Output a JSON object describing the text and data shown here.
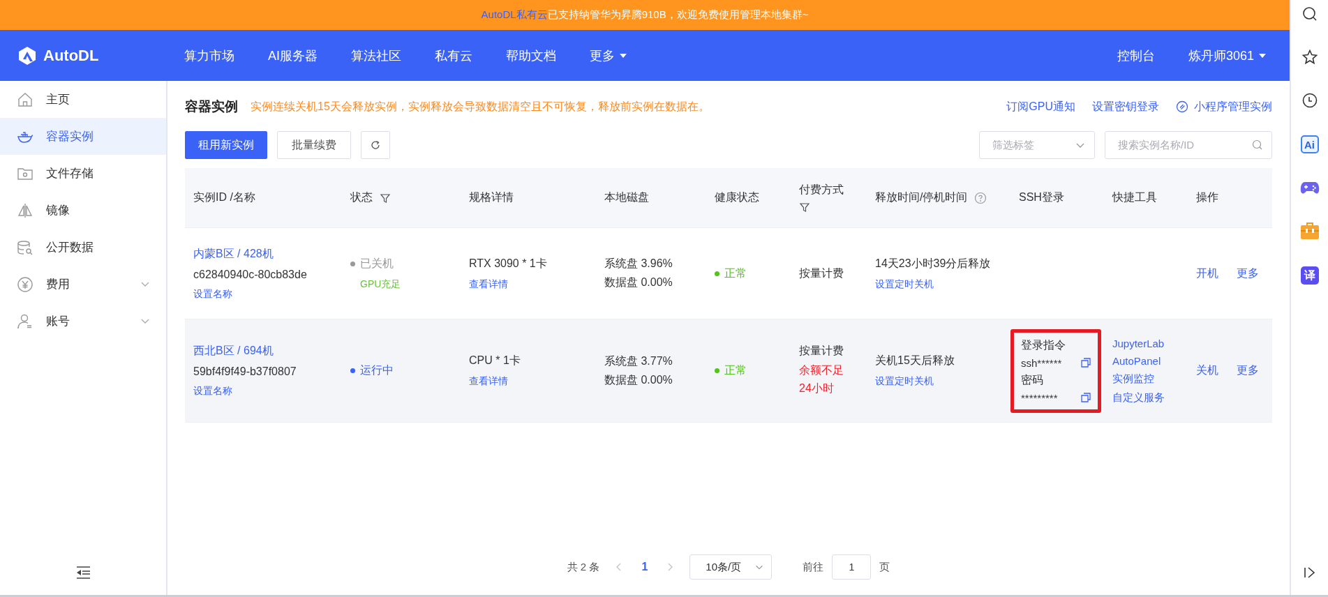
{
  "banner": {
    "link": "AutoDL私有云",
    "text": "已支持纳管华为昇腾910B，欢迎免费使用管理本地集群~"
  },
  "nav": {
    "logo": "AutoDL",
    "items": [
      {
        "label": "算力市场",
        "dropdown": false
      },
      {
        "label": "AI服务器",
        "dropdown": false
      },
      {
        "label": "算法社区",
        "dropdown": false
      },
      {
        "label": "私有云",
        "dropdown": false
      },
      {
        "label": "帮助文档",
        "dropdown": false
      },
      {
        "label": "更多",
        "dropdown": true
      }
    ],
    "console": "控制台",
    "user": "炼丹师3061"
  },
  "sidebar": {
    "items": [
      {
        "label": "主页",
        "kind": "home",
        "selected": false,
        "expandable": false
      },
      {
        "label": "容器实例",
        "kind": "container",
        "selected": true,
        "expandable": false
      },
      {
        "label": "文件存储",
        "kind": "folder",
        "selected": false,
        "expandable": false
      },
      {
        "label": "镜像",
        "kind": "mirror",
        "selected": false,
        "expandable": false
      },
      {
        "label": "公开数据",
        "kind": "database",
        "selected": false,
        "expandable": false
      },
      {
        "label": "费用",
        "kind": "yen",
        "selected": false,
        "expandable": true
      },
      {
        "label": "账号",
        "kind": "user",
        "selected": false,
        "expandable": true
      }
    ]
  },
  "page": {
    "title": "容器实例",
    "notice": "实例连续关机15天会释放实例，实例释放会导致数据清空且不可恢复，释放前实例在数据在。",
    "links": [
      {
        "label": "订阅GPU通知",
        "kind": "plain"
      },
      {
        "label": "设置密钥登录",
        "kind": "plain"
      },
      {
        "label": "小程序管理实例",
        "kind": "mini-program"
      }
    ]
  },
  "toolbar": {
    "buttons": [
      {
        "kind": "primary",
        "label": "租用新实例"
      },
      {
        "kind": "default",
        "label": "批量续费"
      },
      {
        "kind": "refresh"
      }
    ],
    "tag_filter": {
      "placeholder": "筛选标签"
    },
    "search": {
      "placeholder": "搜索实例名称/ID"
    }
  },
  "table": {
    "columns": [
      {
        "label": "实例ID /名称",
        "filter": false,
        "help": false
      },
      {
        "label": "状态",
        "filter": true,
        "help": false
      },
      {
        "label": "规格详情",
        "filter": false,
        "help": false
      },
      {
        "label": "本地磁盘",
        "filter": false,
        "help": false
      },
      {
        "label": "健康状态",
        "filter": false,
        "help": false
      },
      {
        "label": "付费方式",
        "filter": true,
        "help": false
      },
      {
        "label": "释放时间/停机时间",
        "filter": false,
        "help": true
      },
      {
        "label": "SSH登录",
        "filter": false,
        "help": false
      },
      {
        "label": "快捷工具",
        "filter": false,
        "help": false
      },
      {
        "label": "操作",
        "filter": false,
        "help": false
      }
    ],
    "rows": [
      {
        "hovered": false,
        "name": "内蒙B区 / 428机",
        "instance_id": "c62840940c-80cb83de",
        "rename": "设置名称",
        "status": {
          "kind": "stopped",
          "label": "已关机",
          "note": "GPU充足"
        },
        "spec": "RTX 3090 * 1卡",
        "spec_link": "查看详情",
        "disks": [
          "系统盘 3.96%",
          "数据盘 0.00%"
        ],
        "health": {
          "kind": "ok",
          "label": "正常"
        },
        "billing": "按量计费",
        "release": "14天23小时39分后释放",
        "release_link": "设置定时关机",
        "actions": [
          "开机",
          "更多"
        ]
      },
      {
        "hovered": true,
        "name": "西北B区 / 694机",
        "instance_id": "59bf4f9f49-b37f0807",
        "rename": "设置名称",
        "status": {
          "kind": "running",
          "label": "运行中"
        },
        "spec": "CPU * 1卡",
        "spec_link": "查看详情",
        "disks": [
          "系统盘 3.77%",
          "数据盘 0.00%"
        ],
        "health": {
          "kind": "ok",
          "label": "正常"
        },
        "billing": "按量计费",
        "billing_warning": "余额不足24小时",
        "release": "关机15天后释放",
        "release_link": "设置定时关机",
        "ssh": {
          "highlighted": true,
          "command_label": "登录指令",
          "command": "ssh******",
          "password_label": "密码",
          "password": "*********"
        },
        "tools": [
          "JupyterLab",
          "AutoPanel",
          "实例监控",
          "自定义服务"
        ],
        "actions": [
          "关机",
          "更多"
        ]
      }
    ]
  },
  "pagination": {
    "total": "共 2 条",
    "pages": [
      {
        "label": "1",
        "selected": true
      }
    ],
    "page_size": "10条/页",
    "goto_label": "前往",
    "goto_value": "1",
    "goto_suffix": "页"
  },
  "browser_sidebar": {
    "items": [
      {
        "kind": "search"
      },
      {
        "kind": "star"
      },
      {
        "kind": "history"
      },
      {
        "kind": "ai",
        "glyph": "Ai"
      },
      {
        "kind": "game"
      },
      {
        "kind": "toolbox"
      },
      {
        "kind": "translate",
        "glyph": "译"
      }
    ]
  }
}
